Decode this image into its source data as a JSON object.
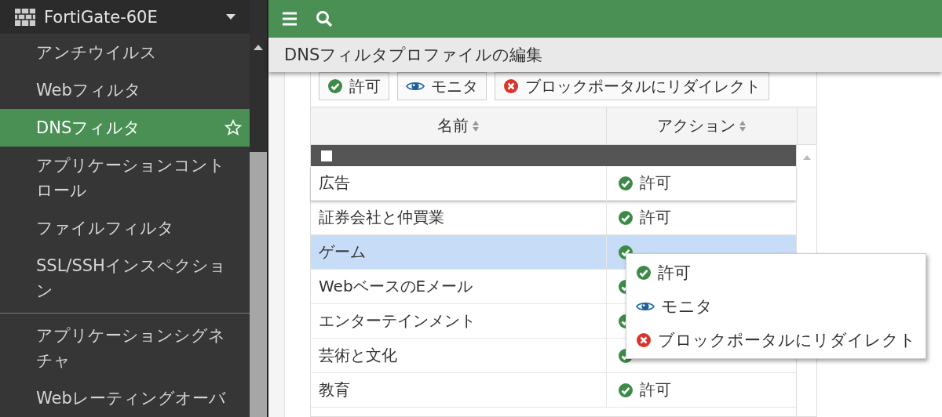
{
  "device": {
    "name": "FortiGate-60E"
  },
  "sidebar": {
    "items": [
      {
        "label": "アンチウイルス",
        "selected": false
      },
      {
        "label": "Webフィルタ",
        "selected": false
      },
      {
        "label": "DNSフィルタ",
        "selected": true
      },
      {
        "label": "アプリケーションコントロール",
        "selected": false
      },
      {
        "label": "ファイルフィルタ",
        "selected": false
      },
      {
        "label": "SSL/SSHインスペクション",
        "selected": false,
        "divider_after": true
      },
      {
        "label": "アプリケーションシグネチャ",
        "selected": false
      },
      {
        "label": "Webレーティングオーバ",
        "selected": false
      }
    ]
  },
  "page_title": "DNSフィルタプロファイルの編集",
  "action_buttons": [
    {
      "kind": "allow",
      "label": "許可"
    },
    {
      "kind": "monitor",
      "label": "モニタ"
    },
    {
      "kind": "redirect",
      "label": "ブロックポータルにリダイレクト"
    }
  ],
  "table": {
    "columns": [
      "名前",
      "アクション"
    ],
    "rows": [
      {
        "name": "広告",
        "action": {
          "kind": "allow",
          "label": "許可"
        },
        "selected": false
      },
      {
        "name": "証券会社と仲買業",
        "action": {
          "kind": "allow",
          "label": "許可"
        },
        "selected": false
      },
      {
        "name": "ゲーム",
        "action": {
          "kind": "allow"
        },
        "selected": true
      },
      {
        "name": "WebベースのEメール",
        "action": {
          "kind": "allow"
        },
        "selected": false
      },
      {
        "name": "エンターテインメント",
        "action": {
          "kind": "allow"
        },
        "selected": false
      },
      {
        "name": "芸術と文化",
        "action": {
          "kind": "allow"
        },
        "selected": false
      },
      {
        "name": "教育",
        "action": {
          "kind": "allow",
          "label": "許可"
        },
        "selected": false
      }
    ]
  },
  "context_menu": [
    {
      "kind": "allow",
      "label": "許可"
    },
    {
      "kind": "monitor",
      "label": "モニタ"
    },
    {
      "kind": "redirect",
      "label": "ブロックポータルにリダイレクト"
    }
  ]
}
